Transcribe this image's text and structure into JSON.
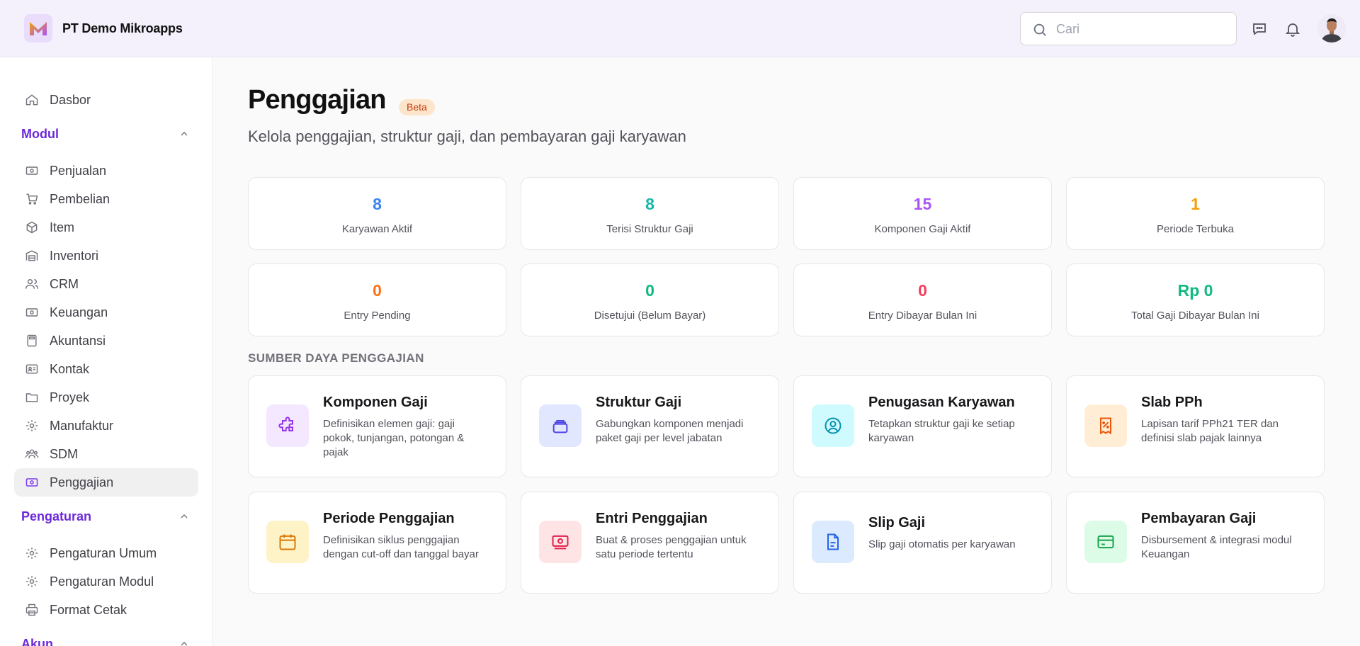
{
  "header": {
    "company": "PT Demo Mikroapps",
    "search_placeholder": "Cari"
  },
  "sidebar": {
    "dashboard": "Dasbor",
    "modul_section": "Modul",
    "modul_items": [
      "Penjualan",
      "Pembelian",
      "Item",
      "Inventori",
      "CRM",
      "Keuangan",
      "Akuntansi",
      "Kontak",
      "Proyek",
      "Manufaktur",
      "SDM",
      "Penggajian"
    ],
    "pengaturan_section": "Pengaturan",
    "pengaturan_items": [
      "Pengaturan Umum",
      "Pengaturan Modul",
      "Format Cetak"
    ],
    "akun_section": "Akun",
    "active_item": "Penggajian"
  },
  "page": {
    "title": "Penggajian",
    "badge": "Beta",
    "subtitle": "Kelola penggajian, struktur gaji, dan pembayaran gaji karyawan"
  },
  "stats": [
    {
      "value": "8",
      "label": "Karyawan Aktif",
      "color": "#3b82f6"
    },
    {
      "value": "8",
      "label": "Terisi Struktur Gaji",
      "color": "#14b8a6"
    },
    {
      "value": "15",
      "label": "Komponen Gaji Aktif",
      "color": "#a855f7"
    },
    {
      "value": "1",
      "label": "Periode Terbuka",
      "color": "#f59e0b"
    },
    {
      "value": "0",
      "label": "Entry Pending",
      "color": "#f97316"
    },
    {
      "value": "0",
      "label": "Disetujui (Belum Bayar)",
      "color": "#10b981"
    },
    {
      "value": "0",
      "label": "Entry Dibayar Bulan Ini",
      "color": "#f43f5e"
    },
    {
      "value": "Rp 0",
      "label": "Total Gaji Dibayar Bulan Ini",
      "color": "#10b981"
    }
  ],
  "resources": {
    "heading": "SUMBER DAYA PENGGAJIAN",
    "items": [
      {
        "title": "Komponen Gaji",
        "desc": "Definisikan elemen gaji: gaji pokok, tunjangan, potongan & pajak",
        "icon": "puzzle-icon",
        "bg": "#f3e8ff",
        "fg": "#9333ea"
      },
      {
        "title": "Struktur Gaji",
        "desc": "Gabungkan komponen menjadi paket gaji per level jabatan",
        "icon": "layers-icon",
        "bg": "#e0e7ff",
        "fg": "#4f46e5"
      },
      {
        "title": "Penugasan Karyawan",
        "desc": "Tetapkan struktur gaji ke setiap karyawan",
        "icon": "user-circle-icon",
        "bg": "#cffafe",
        "fg": "#0891b2"
      },
      {
        "title": "Slab PPh",
        "desc": "Lapisan tarif PPh21 TER dan definisi slab pajak lainnya",
        "icon": "receipt-percent-icon",
        "bg": "#ffedd5",
        "fg": "#ea580c"
      },
      {
        "title": "Periode Penggajian",
        "desc": "Definisikan siklus penggajian dengan cut-off dan tanggal bayar",
        "icon": "calendar-icon",
        "bg": "#fef3c7",
        "fg": "#d97706"
      },
      {
        "title": "Entri Penggajian",
        "desc": "Buat & proses penggajian untuk satu periode tertentu",
        "icon": "cash-icon",
        "bg": "#ffe4e6",
        "fg": "#e11d48"
      },
      {
        "title": "Slip Gaji",
        "desc": "Slip gaji otomatis per karyawan",
        "icon": "document-icon",
        "bg": "#dbeafe",
        "fg": "#2563eb"
      },
      {
        "title": "Pembayaran Gaji",
        "desc": "Disbursement & integrasi modul Keuangan",
        "icon": "credit-card-icon",
        "bg": "#dcfce7",
        "fg": "#16a34a"
      }
    ]
  }
}
